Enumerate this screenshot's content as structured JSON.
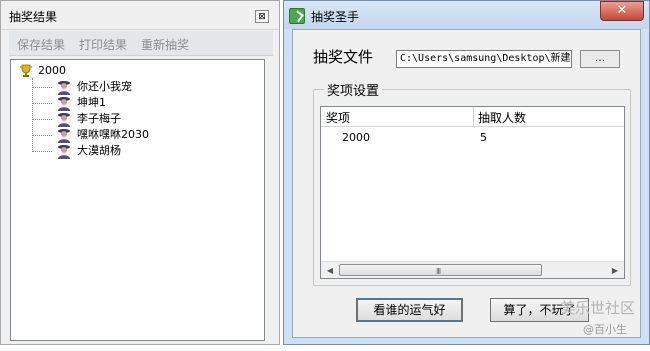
{
  "left_panel": {
    "title": "抽奖结果",
    "close_glyph": "⊠",
    "toolbar": [
      "保存结果",
      "打印结果",
      "重新抽奖"
    ],
    "tree": {
      "root": "2000",
      "children": [
        "你还小我宠",
        "坤坤1",
        "李子梅子",
        "嘿咻嘿咻2030",
        "大漠胡杨"
      ]
    }
  },
  "right_window": {
    "title": "抽奖圣手",
    "close_glyph": "✕",
    "file_label": "抽奖文件",
    "file_path": "C:\\Users\\samsung\\Desktop\\新建",
    "browse_label": "...",
    "group_label": "奖项设置",
    "columns": [
      "奖项",
      "抽取人数"
    ],
    "rows": [
      {
        "prize": "2000",
        "count": "5"
      }
    ],
    "scroll_grip": "III",
    "buttons": {
      "go": "看谁的运气好",
      "quit": "算了，不玩了"
    }
  },
  "watermark": {
    "line1": "美乐世社区",
    "line2": "@百小生"
  },
  "icons": {
    "trophy": "trophy-icon",
    "person": "person-icon",
    "app": "app-icon"
  }
}
